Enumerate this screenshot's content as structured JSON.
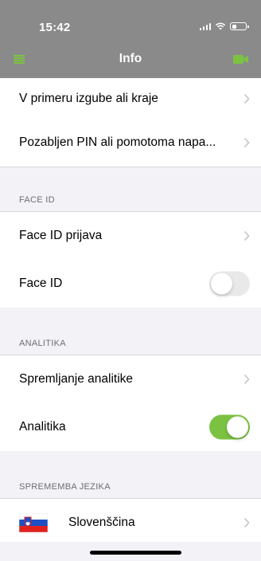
{
  "status_bar": {
    "time": "15:42"
  },
  "header": {
    "title": "Info",
    "icons": [
      "menu-icon",
      "video-camera-icon"
    ]
  },
  "colors": {
    "header_bg": "#8a8a8a",
    "accent": "#7cc242",
    "background": "#f2f2f7"
  },
  "rows_top": [
    {
      "label": "V primeru izgube ali kraje"
    },
    {
      "label": "Pozabljen PIN ali pomotoma napa..."
    }
  ],
  "sections": {
    "face_id": {
      "header": "FACE ID",
      "login_label": "Face ID prijava",
      "toggle_label": "Face ID",
      "toggle_on": false
    },
    "analytics": {
      "header": "ANALITIKA",
      "tracking_label": "Spremljanje analitike",
      "toggle_label": "Analitika",
      "toggle_on": true
    },
    "language": {
      "header": "SPREMEMBA JEZIKA",
      "current": "Slovenščina",
      "flag": "slovenia-flag-icon"
    }
  }
}
